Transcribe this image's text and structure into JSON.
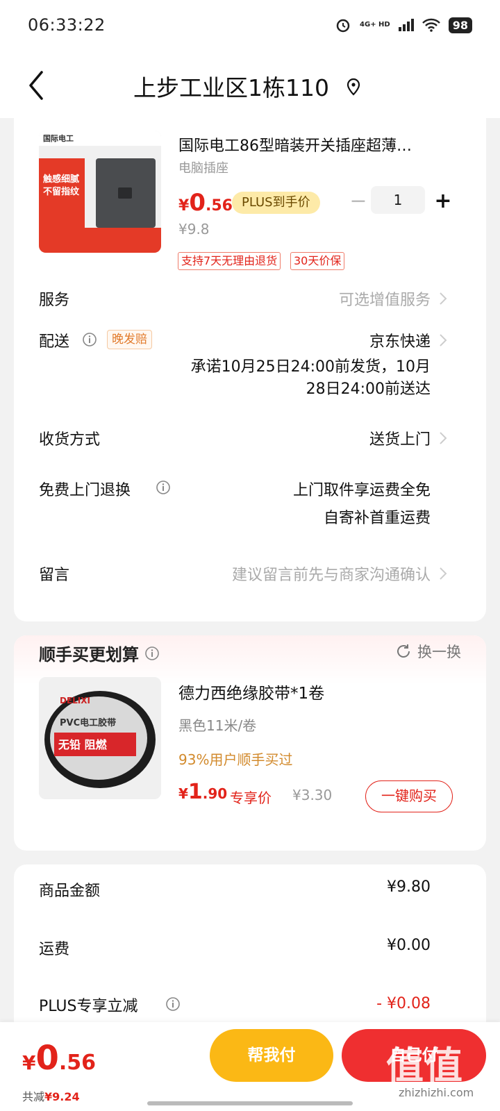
{
  "status_bar": {
    "time": "06:33:22",
    "network": "4G+ HD",
    "battery": "98"
  },
  "header": {
    "title": "上步工业区1栋110"
  },
  "product": {
    "title": "国际电工86型暗装开关插座超薄…",
    "subtitle": "电脑插座",
    "price_yen": "¥",
    "price_int": "0",
    "price_dec": ".56",
    "plus_badge": "PLUS到手价",
    "original_price": "¥9.8",
    "quantity": "1",
    "tags": [
      "支持7天无理由退货",
      "30天价保"
    ],
    "image_text": {
      "brand": "国际电工",
      "feature1": "触感细腻",
      "feature2": "不留指纹"
    }
  },
  "rows": {
    "service": {
      "label": "服务",
      "value": "可选增值服务"
    },
    "delivery": {
      "label": "配送",
      "badge": "晚发赔",
      "value": "京东快递",
      "promise_line1": "承诺10月25日24:00前发货，10月",
      "promise_line2": "28日24:00前送达"
    },
    "receive": {
      "label": "收货方式",
      "value": "送货上门"
    },
    "free_return": {
      "label": "免费上门退换",
      "value_line1": "上门取件享运费全免",
      "value_line2": "自寄补首重运费"
    },
    "message": {
      "label": "留言",
      "placeholder": "建议留言前先与商家沟通确认"
    }
  },
  "addon": {
    "title": "顺手买更划算",
    "swap": "换一换",
    "name": "德力西绝缘胶带*1卷",
    "spec": "黑色11米/卷",
    "promo": "93%用户顺手买过",
    "price_yen": "¥",
    "price_int": "1",
    "price_dec": ".90",
    "exclusive": "专享价",
    "original_price": "¥3.30",
    "buy_button": "一键购买",
    "image_text": {
      "brand": "DELIXI",
      "line1": "PVC电工胶带",
      "line2": "无铅 阻燃"
    }
  },
  "summary": [
    {
      "label": "商品金额",
      "value": "¥9.80"
    },
    {
      "label": "运费",
      "value": "¥0.00"
    },
    {
      "label": "PLUS专享立减",
      "value": "- ¥0.08"
    }
  ],
  "bottom": {
    "total_yen": "¥",
    "total_int": "0",
    "total_dec": ".56",
    "saved_label": "共减",
    "saved_value": "¥9.24",
    "pay_for_me": "帮我付",
    "submit": "自己付",
    "watermark": "值值值",
    "watermark_sub": "zhizhizhi.com"
  },
  "colors": {
    "accent": "#e2231a",
    "plus_badge_bg": "#fdeaa8",
    "yellow_button": "#fbb815",
    "red_button": "#ef2f30"
  }
}
